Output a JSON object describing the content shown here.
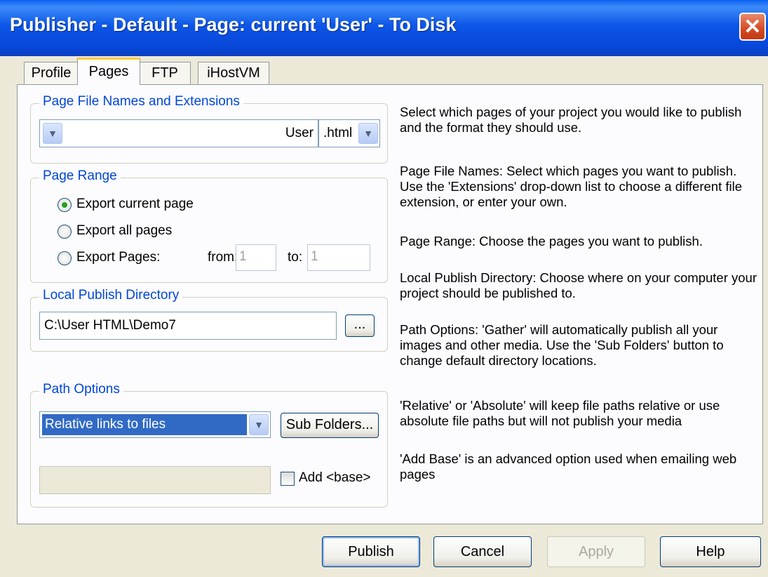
{
  "window": {
    "title": "Publisher - Default - Page: current 'User' - To Disk",
    "close_glyph": "✕"
  },
  "tabs": [
    {
      "label": "Profile",
      "active": false
    },
    {
      "label": "Pages",
      "active": true
    },
    {
      "label": "FTP",
      "active": false
    },
    {
      "label": "iHostVM",
      "active": false
    }
  ],
  "file_names": {
    "title": "Page File Names and Extensions",
    "page_value": "User",
    "extension_value": ".html"
  },
  "page_range": {
    "title": "Page Range",
    "options": [
      {
        "label": "Export current page",
        "selected": true
      },
      {
        "label": "Export all pages",
        "selected": false
      },
      {
        "label": "Export Pages:",
        "selected": false
      }
    ],
    "from_label": "from:",
    "from_value": "1",
    "to_label": "to:",
    "to_value": "1"
  },
  "local_dir": {
    "title": "Local Publish Directory",
    "path": "C:\\User HTML\\Demo7",
    "browse_label": "..."
  },
  "path_options": {
    "title": "Path Options",
    "selected": "Relative links to files",
    "subfolders_label": "Sub Folders...",
    "base_value": "",
    "add_base_label": "Add <base>",
    "add_base_checked": false
  },
  "help": {
    "p1": "Select which pages of your project you would like to publish and the format they should use.",
    "p2": "Page File Names: Select which pages you want to publish. Use the 'Extensions' drop-down list to choose a different file extension, or enter your own.",
    "p3": "Page Range: Choose the pages you want to publish.",
    "p4": "Local Publish Directory: Choose where on your computer your project should be published to.",
    "p5": "Path Options: 'Gather' will automatically publish all your images and other media. Use the 'Sub Folders' button to change default directory locations.",
    "p6": "'Relative' or 'Absolute' will keep file paths relative or use absolute file paths but will not publish your media",
    "p7": "'Add Base' is an advanced option used when emailing web pages"
  },
  "buttons": {
    "publish": "Publish",
    "cancel": "Cancel",
    "apply": "Apply",
    "help": "Help"
  },
  "icons": {
    "dropdown": "chevron-down-icon",
    "close": "close-icon"
  },
  "colors": {
    "titlebar": "#0a4fe0",
    "group_title": "#0046d5",
    "selection": "#316ac5",
    "window_bg": "#ece9d8"
  }
}
